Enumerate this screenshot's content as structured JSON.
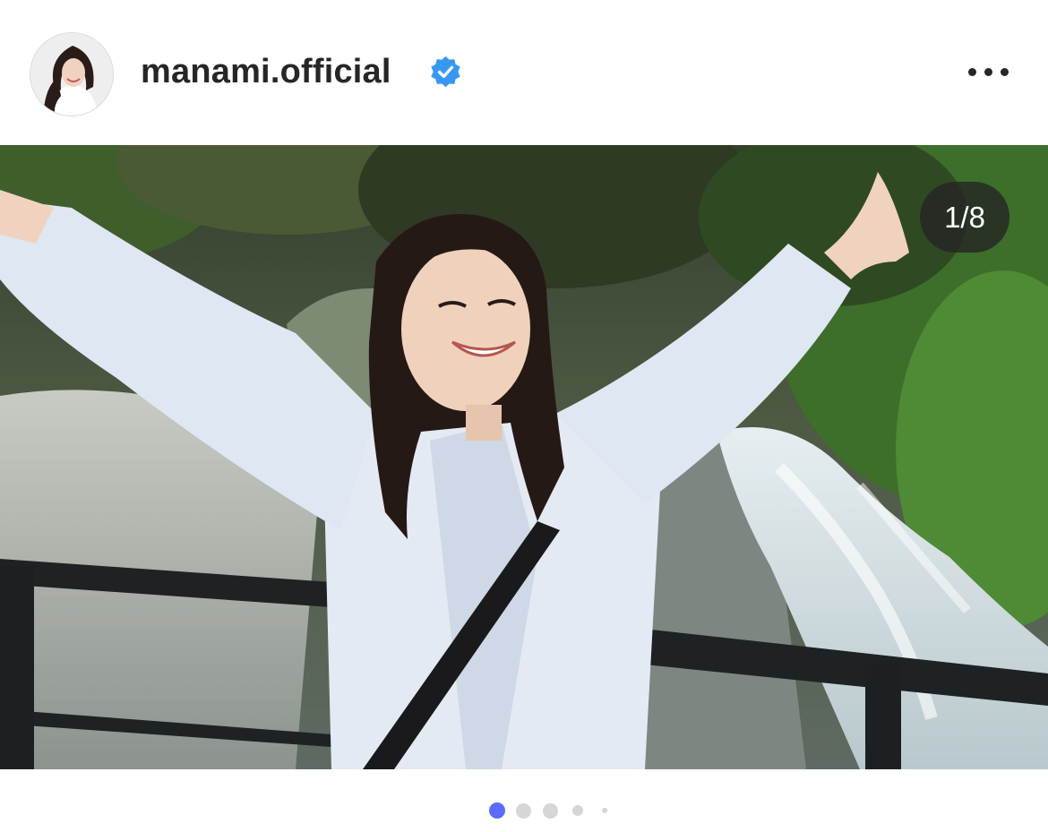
{
  "post": {
    "username": "manami.official",
    "verified": true,
    "avatar_icon": "profile-avatar",
    "verified_icon": "verified-badge-icon",
    "more_icon": "more-options-icon",
    "verified_color": "#3897f0"
  },
  "carousel": {
    "counter": "1/8",
    "current_index": 1,
    "total": 8,
    "visible_dots": 5,
    "active_dot_color": "#5b6bff",
    "inactive_dot_color": "#d6d6d6"
  }
}
